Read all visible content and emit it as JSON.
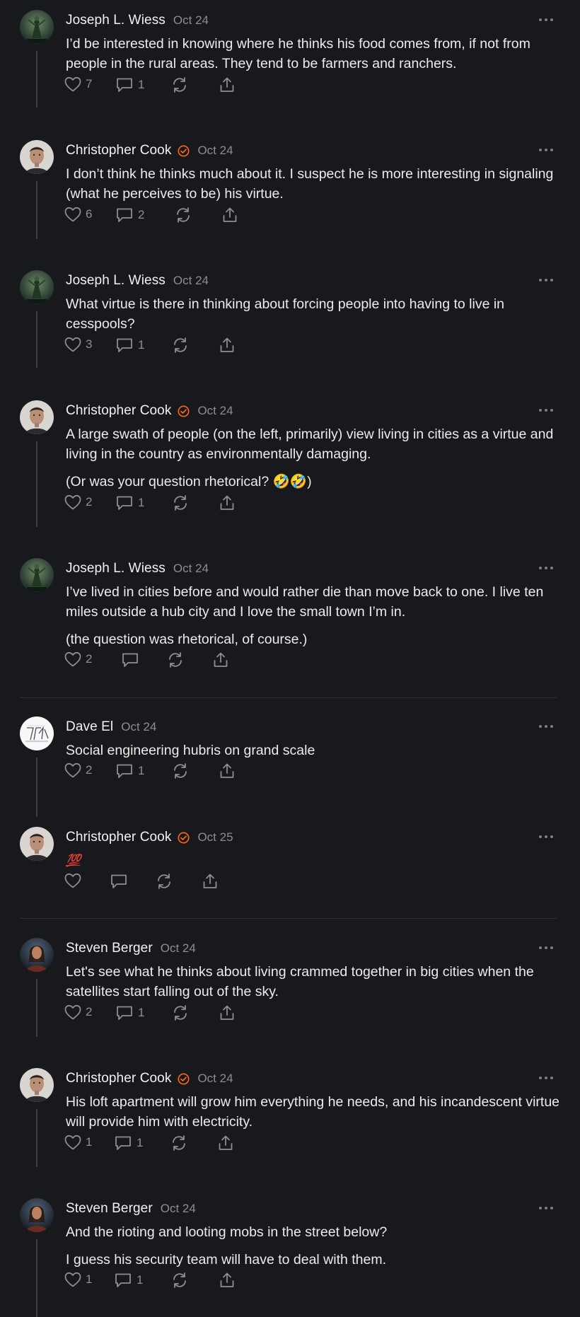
{
  "comments": [
    {
      "author": "Joseph L. Wiess",
      "verified": false,
      "date": "Oct 24",
      "avatar": "green-warrior-avatar",
      "paragraphs": [
        "I’d be interested in knowing where he thinks his food comes from, if not from people in the rural areas. They tend to be farmers and ranchers."
      ],
      "likes": "7",
      "replies": "1"
    },
    {
      "author": "Christopher Cook",
      "verified": true,
      "date": "Oct 24",
      "avatar": "man-portrait-avatar",
      "paragraphs": [
        "I don’t think he thinks much about it. I suspect he is more interesting in signaling (what he perceives to be) his virtue."
      ],
      "likes": "6",
      "replies": "2"
    },
    {
      "author": "Joseph L. Wiess",
      "verified": false,
      "date": "Oct 24",
      "avatar": "green-warrior-avatar",
      "paragraphs": [
        "What virtue is there in thinking about forcing people into having to live in cesspools?"
      ],
      "likes": "3",
      "replies": "1"
    },
    {
      "author": "Christopher Cook",
      "verified": true,
      "date": "Oct 24",
      "avatar": "man-portrait-avatar",
      "paragraphs": [
        "A large swath of people (on the left, primarily) view living in cities as a virtue and living in the country as environmentally damaging.",
        "(Or was your question rhetorical? 🤣🤣)"
      ],
      "likes": "2",
      "replies": "1"
    },
    {
      "author": "Joseph L. Wiess",
      "verified": false,
      "date": "Oct 24",
      "avatar": "green-warrior-avatar",
      "paragraphs": [
        "I’ve lived in cities before and would rather die than move back to one. I live ten miles outside a hub city and I love the small town I’m in.",
        "(the question was rhetorical, of course.)"
      ],
      "likes": "2",
      "replies": ""
    },
    {
      "author": "Dave El",
      "verified": false,
      "date": "Oct 24",
      "avatar": "sketch-logo-avatar",
      "paragraphs": [
        "Social engineering hubris on grand scale"
      ],
      "likes": "2",
      "replies": "1"
    },
    {
      "author": "Christopher Cook",
      "verified": true,
      "date": "Oct 25",
      "avatar": "man-portrait-avatar",
      "paragraphs": [
        "💯"
      ],
      "likes": "",
      "replies": ""
    },
    {
      "author": "Steven Berger",
      "verified": false,
      "date": "Oct 24",
      "avatar": "painted-portrait-avatar",
      "paragraphs": [
        "Let's see what he thinks about living crammed together in big cities when the satellites start falling out of the sky."
      ],
      "likes": "2",
      "replies": "1"
    },
    {
      "author": "Christopher Cook",
      "verified": true,
      "date": "Oct 24",
      "avatar": "man-portrait-avatar",
      "paragraphs": [
        "His loft apartment will grow him everything he needs, and his incandescent virtue will provide him with electricity."
      ],
      "likes": "1",
      "replies": "1"
    },
    {
      "author": "Steven Berger",
      "verified": false,
      "date": "Oct 24",
      "avatar": "painted-portrait-avatar",
      "paragraphs": [
        "And the rioting and looting mobs in the street below?",
        "I guess his security team will have to deal with them."
      ],
      "likes": "1",
      "replies": "1"
    }
  ],
  "colors": {
    "background": "#18191c",
    "verified": "#ff6719",
    "muted": "#8d8d92",
    "thread_line": "#3c3d42"
  }
}
